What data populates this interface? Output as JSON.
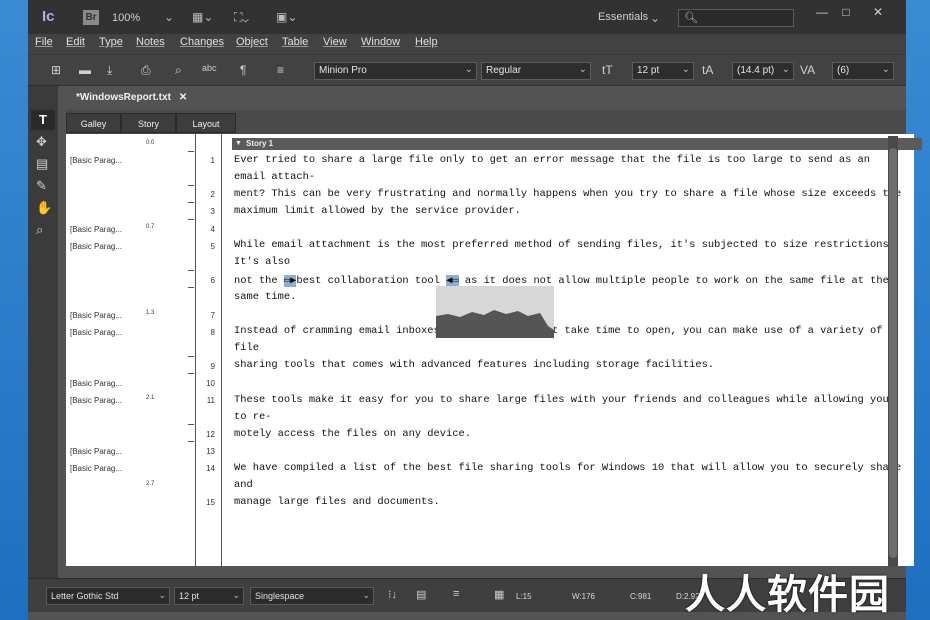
{
  "app": {
    "logo": "Ic",
    "bridge": "Br",
    "zoom": "100%",
    "workspace": "Essentials",
    "search_placeholder": ""
  },
  "menu": [
    "File",
    "Edit",
    "Type",
    "Notes",
    "Changes",
    "Object",
    "Table",
    "View",
    "Window",
    "Help"
  ],
  "control_bar": {
    "font": "Minion Pro",
    "style": "Regular",
    "size": "12 pt",
    "leading": "(14.4 pt)",
    "tracking": "(6)"
  },
  "document": {
    "tab": "*WindowsReport.txt"
  },
  "view_tabs": [
    "Galley",
    "Story",
    "Layout"
  ],
  "story": {
    "title": "Story 1",
    "depth_labels": [
      "0.0",
      "0.7",
      "1.3",
      "2.1",
      "2.7"
    ],
    "paragraph_styles": [
      "[Basic Parag...",
      "[Basic Parag...",
      "[Basic Parag...",
      "[Basic Parag...",
      "[Basic Parag...",
      "[Basic Parag...",
      "[Basic Parag...",
      "[Basic Parag...",
      "[Basic Parag...",
      "[Basic Parag...",
      "[Basic Parag..."
    ],
    "line_numbers": [
      "1",
      "2",
      "3",
      "4",
      "5",
      "6",
      "7",
      "8",
      "9",
      "10",
      "11",
      "12",
      "13",
      "14",
      "15"
    ],
    "lines": [
      "Ever tried to share a large file only to get an error message that the file is too large to send as an",
      "email attach-",
      "ment? This can be very frustrating and normally happens when you try to share a file whose size exceeds the",
      "maximum limit allowed by the service provider.",
      "While email attachment is the most preferred method of sending files, it's subjected to size restrictions.",
      "It's also",
      "best collaboration tool",
      "as it does not allow multiple people to work on the same file at the",
      "not the",
      "same time.",
      "Instead of cramming email inboxes",
      "hat take time to open, you can make use of a variety of",
      "file",
      "sharing tools that comes with advanced features including storage facilities.",
      "These tools make it easy for you to share large files with your friends and colleagues while allowing you",
      "to re-",
      "motely access the files on any device.",
      "We have compiled a list of the best file sharing tools for Windows 10 that will allow you to securely share",
      "and",
      "manage large files and documents."
    ]
  },
  "status_bar": {
    "font": "Letter Gothic Std",
    "size": "12 pt",
    "spacing": "Singlespace",
    "lines": "L:15",
    "words": "W:176",
    "chars": "C:981",
    "depth": "D:2.92i"
  },
  "watermark": "人人软件园"
}
